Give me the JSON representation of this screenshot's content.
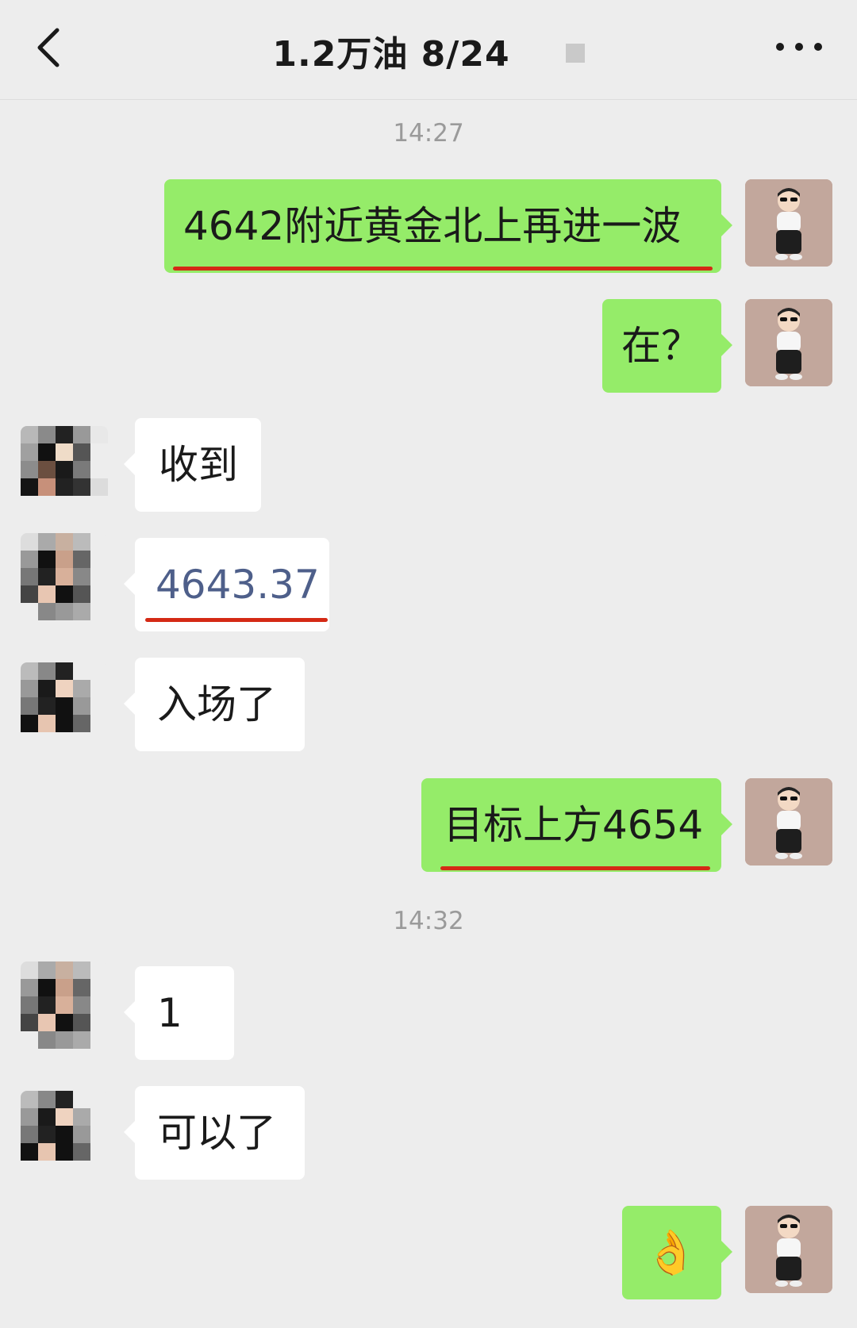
{
  "header": {
    "back_icon": "chevron-left-icon",
    "title": "1.2万油  8/24",
    "more_icon": "ellipsis-icon"
  },
  "chat": {
    "time_1": "14:27",
    "msg_1": "4642附近黄金北上再进一波",
    "msg_2": "在？",
    "msg_3": "收到",
    "msg_4": "4643.37",
    "msg_5": "入场了",
    "msg_6": "目标上方4654",
    "time_2": "14:32",
    "msg_7": "1",
    "msg_8": "可以了",
    "msg_9": "👌"
  },
  "colors": {
    "background": "#ededed",
    "sent_bubble": "#95ec69",
    "received_bubble": "#ffffff",
    "underline": "#d42a15"
  }
}
